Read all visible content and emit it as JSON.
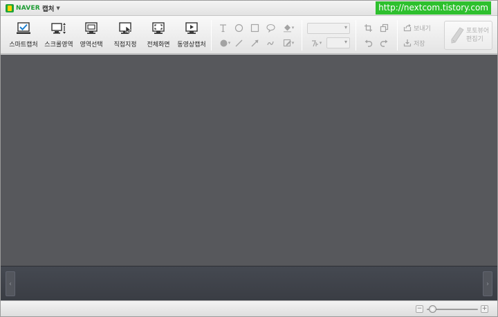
{
  "titlebar": {
    "brand": "NAVER",
    "app_name": "캡처",
    "watermark": "http://nextcom.tistory.com"
  },
  "capture_modes": [
    {
      "label": "스마트캡처",
      "icon": "smart-capture-icon"
    },
    {
      "label": "스크롤영역",
      "icon": "scroll-area-icon"
    },
    {
      "label": "영역선택",
      "icon": "area-select-icon"
    },
    {
      "label": "직접지정",
      "icon": "manual-select-icon"
    },
    {
      "label": "전체화면",
      "icon": "fullscreen-icon"
    },
    {
      "label": "동영상캡처",
      "icon": "video-capture-icon"
    }
  ],
  "actions": {
    "send_label": "보내기",
    "save_label": "저장",
    "editor_label": "포토뷰어 편집기"
  },
  "zoom": {
    "minus": "−",
    "plus": "+",
    "level": 0.05
  },
  "colors": {
    "canvas": "#57585c",
    "thumb_strip": "#3f4249",
    "watermark": "#2ec02e",
    "brand": "#1c9c33"
  }
}
